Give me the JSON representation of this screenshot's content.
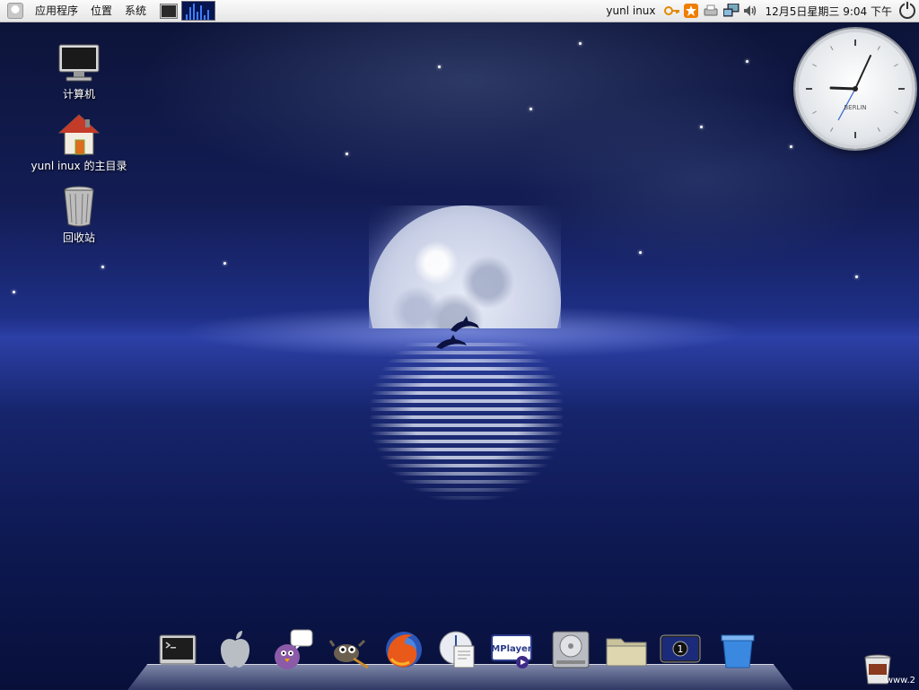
{
  "top_panel": {
    "menu": {
      "applications": "应用程序",
      "places": "位置",
      "system": "系统"
    },
    "username": "yunl inux",
    "datetime": "12月5日星期三  9:04 下午"
  },
  "desktop_icons": [
    {
      "label": "计算机",
      "icon": "computer-icon"
    },
    {
      "label": "yunl inux 的主目录",
      "icon": "home-folder-icon"
    },
    {
      "label": "回收站",
      "icon": "trash-icon"
    }
  ],
  "clock_widget": {
    "brand": "BERLIN",
    "time": "9:04"
  },
  "dock": {
    "items": [
      {
        "name": "terminal",
        "icon": "terminal-icon"
      },
      {
        "name": "apple",
        "icon": "apple-icon"
      },
      {
        "name": "pidgin",
        "icon": "pidgin-icon"
      },
      {
        "name": "gimp",
        "icon": "gimp-icon"
      },
      {
        "name": "firefox",
        "icon": "firefox-icon"
      },
      {
        "name": "evolution",
        "icon": "mail-calendar-icon"
      },
      {
        "name": "mplayer",
        "icon": "mplayer-icon",
        "label": "MPlayer"
      },
      {
        "name": "drive",
        "icon": "hard-drive-icon"
      },
      {
        "name": "folder",
        "icon": "folder-icon"
      },
      {
        "name": "workspace",
        "icon": "workspace-icon",
        "label": "1"
      },
      {
        "name": "trash-bin",
        "icon": "recycle-bin-icon"
      }
    ]
  },
  "watermark": "www.2"
}
